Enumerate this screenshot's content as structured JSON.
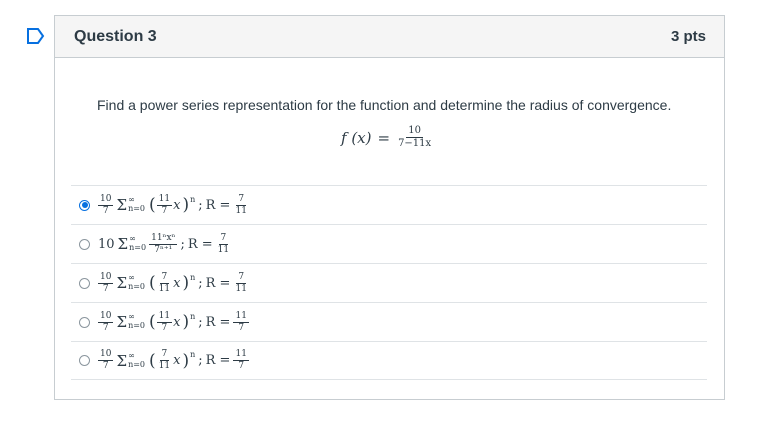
{
  "flag_icon": "bookmark-flag-icon",
  "question": {
    "title": "Question 3",
    "points": "3 pts",
    "text": "Find a power series representation for the function and determine the radius of convergence.",
    "formula": {
      "lhs": "f (x)",
      "eq": "=",
      "num": "10",
      "den": "7−11x"
    }
  },
  "answers": [
    {
      "selected": true,
      "coef_num": "10",
      "coef_den": "7",
      "sum_top": "∞",
      "sum_bottom": "n=0",
      "term": "(11/7 x)^n",
      "in_num": "11",
      "in_den": "7",
      "exp": "n",
      "r_label": "R =",
      "r_num": "7",
      "r_den": "11"
    },
    {
      "selected": false,
      "coef": "10",
      "sum_top": "∞",
      "sum_bottom": "n=0",
      "term_num": "11ⁿxⁿ",
      "term_den": "7ⁿ⁺¹",
      "r_label": "R =",
      "r_num": "7",
      "r_den": "11"
    },
    {
      "selected": false,
      "coef_num": "10",
      "coef_den": "7",
      "sum_top": "∞",
      "sum_bottom": "n=0",
      "in_num": "7",
      "in_den": "11",
      "exp": "n",
      "r_label": "R =",
      "r_num": "7",
      "r_den": "11"
    },
    {
      "selected": false,
      "coef_num": "10",
      "coef_den": "7",
      "sum_top": "∞",
      "sum_bottom": "n=0",
      "in_num": "11",
      "in_den": "7",
      "exp": "n",
      "r_label": "R =",
      "r_num": "11",
      "r_den": "7"
    },
    {
      "selected": false,
      "coef_num": "10",
      "coef_den": "7",
      "sum_top": "∞",
      "sum_bottom": "n=0",
      "in_num": "7",
      "in_den": "11",
      "exp": "n",
      "r_label": "R =",
      "r_num": "11",
      "r_den": "7"
    }
  ],
  "colors": {
    "accent": "#0770e0",
    "text": "#2d3b45",
    "border": "#c7cdd1",
    "header_bg": "#f5f5f5"
  }
}
